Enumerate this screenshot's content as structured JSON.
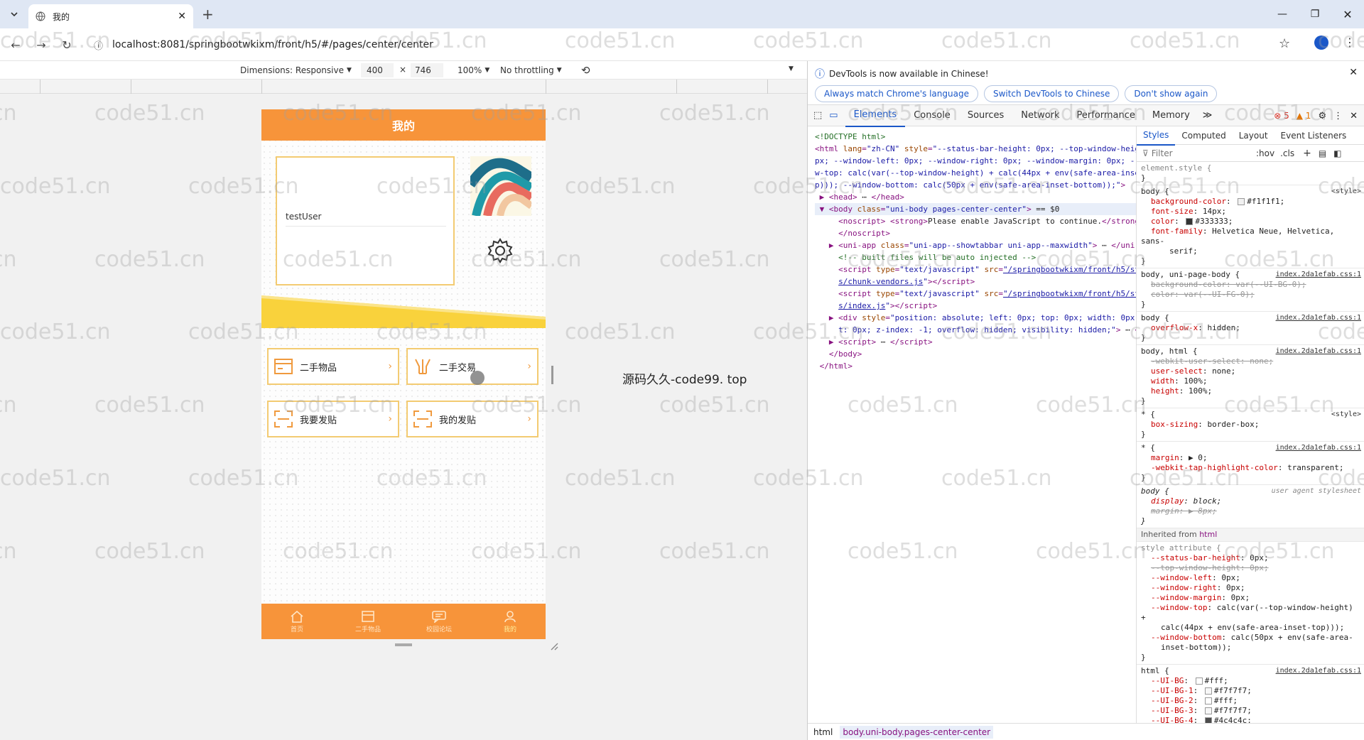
{
  "browser": {
    "tab_title": "我的",
    "url": "localhost:8081/springbootwkixm/front/h5/#/pages/center/center"
  },
  "device_toolbar": {
    "dimensions_label": "Dimensions: Responsive",
    "width": "400",
    "times": "×",
    "height": "746",
    "zoom": "100%",
    "throttling": "No throttling"
  },
  "app": {
    "nav_title": "我的",
    "username": "testUser",
    "tiles": [
      {
        "label": "二手物品",
        "icon": "card-icon"
      },
      {
        "label": "二手交易",
        "icon": "trade-icon"
      },
      {
        "label": "我要发贴",
        "icon": "scan-icon"
      },
      {
        "label": "我的发贴",
        "icon": "scan-icon"
      }
    ],
    "chevron": "›",
    "tabbar": [
      {
        "label": "首页",
        "icon": "home-icon"
      },
      {
        "label": "二手物品",
        "icon": "box-icon"
      },
      {
        "label": "校园论坛",
        "icon": "chat-icon"
      },
      {
        "label": "我的",
        "icon": "user-icon",
        "active": true
      }
    ]
  },
  "overlay_text": "源码久久-code99. top",
  "watermark": "code51.cn",
  "devtools": {
    "info_message": "DevTools is now available in Chinese!",
    "info_buttons": [
      "Always match Chrome's language",
      "Switch DevTools to Chinese",
      "Don't show again"
    ],
    "tabs": [
      "Elements",
      "Console",
      "Sources",
      "Network",
      "Performance",
      "Memory"
    ],
    "errors_count": "5",
    "warnings_count": "1",
    "styles_tabs": [
      "Styles",
      "Computed",
      "Layout",
      "Event Listeners"
    ],
    "filter_placeholder": "Filter",
    "hov": ":hov",
    "cls": ".cls",
    "breadcrumb": [
      "html",
      "body.uni-body.pages-center-center"
    ]
  },
  "colors": {
    "accent_orange": "#f7943a",
    "tile_border": "#f3cb72",
    "yellow_band": "#f9d23c",
    "devtools_blue": "#1a57c8"
  }
}
